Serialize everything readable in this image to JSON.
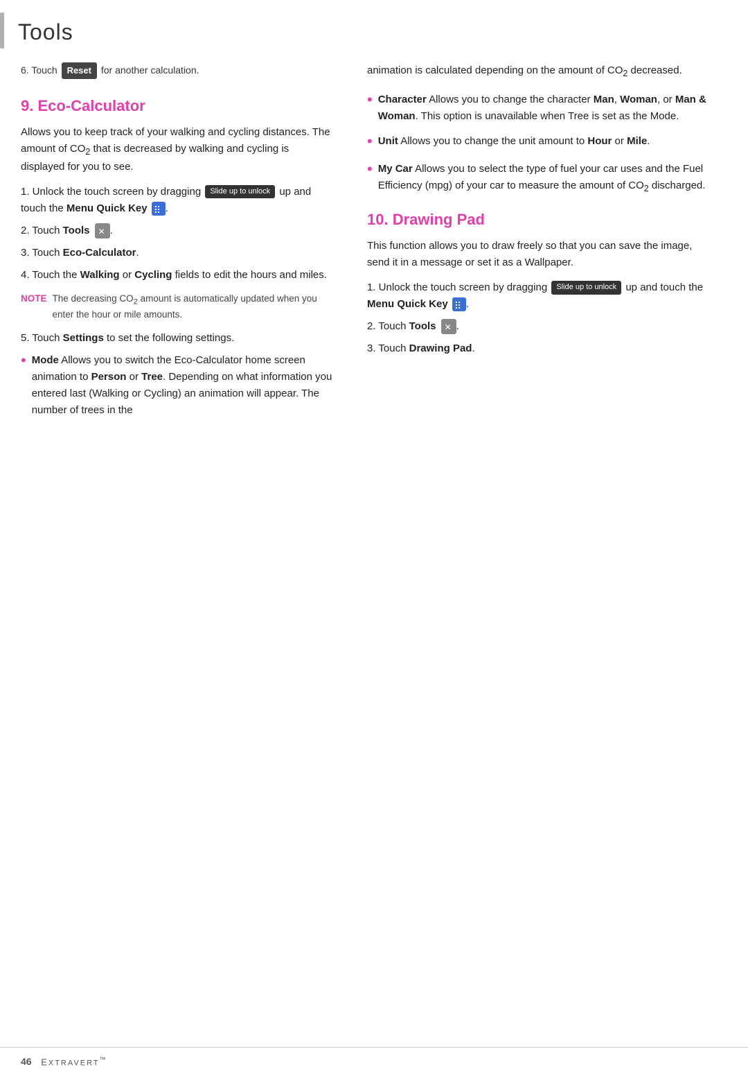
{
  "page": {
    "title": "Tools",
    "accent_color": "#e040ab",
    "footer": {
      "page_number": "46",
      "brand": "Extravert",
      "trademark": "™"
    }
  },
  "left_col": {
    "top_note": {
      "text_before": "6. Touch",
      "reset_label": "Reset",
      "text_after": "for another calculation."
    },
    "eco_calculator": {
      "heading": "9. Eco-Calculator",
      "intro": "Allows you to keep track of your walking and cycling distances. The amount of CO₂ that is decreased by walking and cycling is displayed for you to see.",
      "steps": [
        {
          "num": "1.",
          "text_before": "Unlock the touch screen by dragging",
          "slide_badge": "Slide up to unlock",
          "text_after": "up and touch the",
          "bold_after": "Menu Quick Key",
          "has_menu_key": true
        },
        {
          "num": "2.",
          "text_before": "Touch",
          "bold": "Tools",
          "has_tools_icon": true
        },
        {
          "num": "3.",
          "text_before": "Touch",
          "bold": "Eco-Calculator",
          "text_after": "."
        },
        {
          "num": "4.",
          "text_before": "Touch the",
          "bold1": "Walking",
          "text_mid": "or",
          "bold2": "Cycling",
          "text_after": "fields to edit the hours and miles."
        }
      ],
      "note": {
        "label": "NOTE",
        "text": "The decreasing CO₂ amount is automatically updated when you enter the hour or mile amounts."
      },
      "step5": {
        "num": "5.",
        "text_before": "Touch",
        "bold": "Settings",
        "text_after": "to set the following settings."
      },
      "bullets": [
        {
          "bold": "Mode",
          "text": "Allows you to switch the Eco-Calculator home screen animation to",
          "bold2": "Person",
          "text2": "or",
          "bold3": "Tree",
          "text3": ". Depending on what information you entered last (Walking or Cycling) an animation will appear. The number of trees in the"
        }
      ]
    }
  },
  "right_col": {
    "continued_text": "animation is calculated depending on the amount of CO₂ decreased.",
    "bullets": [
      {
        "bold": "Character",
        "text": "Allows you to change the character",
        "bold2": "Man",
        "text2": ",",
        "bold3": "Woman",
        "text3": ", or",
        "bold4": "Man & Woman",
        "text4": ". This option is unavailable when Tree is set as the Mode."
      },
      {
        "bold": "Unit",
        "text": "Allows you to change the unit amount to",
        "bold2": "Hour",
        "text2": "or",
        "bold3": "Mile",
        "text3": "."
      },
      {
        "bold": "My Car",
        "text": "Allows you to select the type of fuel your car uses and the Fuel Efficiency (mpg) of your car to measure the amount of CO₂ discharged."
      }
    ],
    "drawing_pad": {
      "heading": "10. Drawing Pad",
      "intro": "This function allows you to draw freely so that you can save the image, send it in a message or set it as a Wallpaper.",
      "steps": [
        {
          "num": "1.",
          "text_before": "Unlock the touch screen by dragging",
          "slide_badge": "Slide up to unlock",
          "text_after": "up and touch the",
          "bold_after": "Menu Quick Key",
          "has_menu_key": true
        },
        {
          "num": "2.",
          "text_before": "Touch",
          "bold": "Tools",
          "has_tools_icon": true
        },
        {
          "num": "3.",
          "text_before": "Touch",
          "bold": "Drawing Pad",
          "text_after": "."
        }
      ]
    }
  }
}
